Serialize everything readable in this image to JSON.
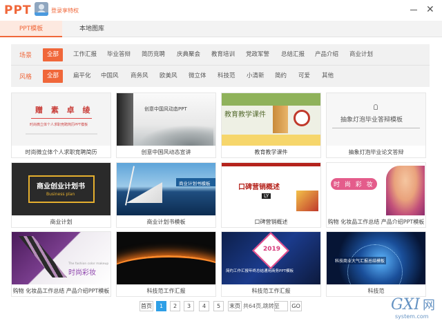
{
  "app": {
    "logo": "PPT",
    "login": "登录享特权"
  },
  "tabs": [
    {
      "label": "PPT模板"
    },
    {
      "label": "本地图库"
    }
  ],
  "filter": {
    "scene_label": "场景",
    "scenes": [
      "全部",
      "工作汇报",
      "毕业答辩",
      "简历竞聘",
      "庆典聚会",
      "教育培训",
      "党政军警",
      "总结汇报",
      "产品介绍",
      "商业计划"
    ],
    "style_label": "风格",
    "styles": [
      "全部",
      "扁平化",
      "中国风",
      "商务风",
      "欧美风",
      "微立体",
      "科技范",
      "小清新",
      "简约",
      "可爱",
      "其他"
    ]
  },
  "cards": [
    {
      "title": "时尚微立体个人求职竞聘简历",
      "thumb_text": "赠 素 卓 绫",
      "thumb_sub": "时尚微立体个人求职竞聘简历PPT模板"
    },
    {
      "title": "创意中国风动态宣讲",
      "thumb_text": "创意中国风动态PPT"
    },
    {
      "title": "教育教学课件",
      "thumb_text": "教育教学课件"
    },
    {
      "title": "抽象灯泡毕业论文答辩",
      "thumb_text": "抽象灯泡毕业答辩模板"
    },
    {
      "title": "商业计划",
      "thumb_text": "商业创业计划书",
      "thumb_sub": "Business plan"
    },
    {
      "title": "商业计划书模板",
      "thumb_text": "商业计划书模板"
    },
    {
      "title": "口碑营销概述",
      "thumb_text": "口碑营销概述",
      "thumb_sub": "LY"
    },
    {
      "title": "购物 化妆品工作总结 产品介绍PPT模板",
      "thumb_text": "时 尚 彩 妆"
    },
    {
      "title": "购物 化妆品工作总结 产品介绍PPT模板",
      "thumb_text": "时尚彩妆",
      "thumb_sub": "The fashion color makeup"
    },
    {
      "title": "科技范工作汇报",
      "thumb_text": ""
    },
    {
      "title": "科技范工作汇报",
      "thumb_text": "简约工作汇报年终总结通用商务PPT模板",
      "thumb_sub": "2019"
    },
    {
      "title": "科技范",
      "thumb_text": "科技商业大气汇报总结模板"
    }
  ],
  "pager": {
    "first": "首页",
    "pages": [
      "1",
      "2",
      "3",
      "4",
      "5"
    ],
    "current": "1",
    "last": "末页",
    "total": "共64页,跳转至",
    "go": "GO"
  },
  "watermark": "GXI网 system.com",
  "colors": {
    "accent": "#f0673a",
    "page_current": "#2e9fe6"
  }
}
